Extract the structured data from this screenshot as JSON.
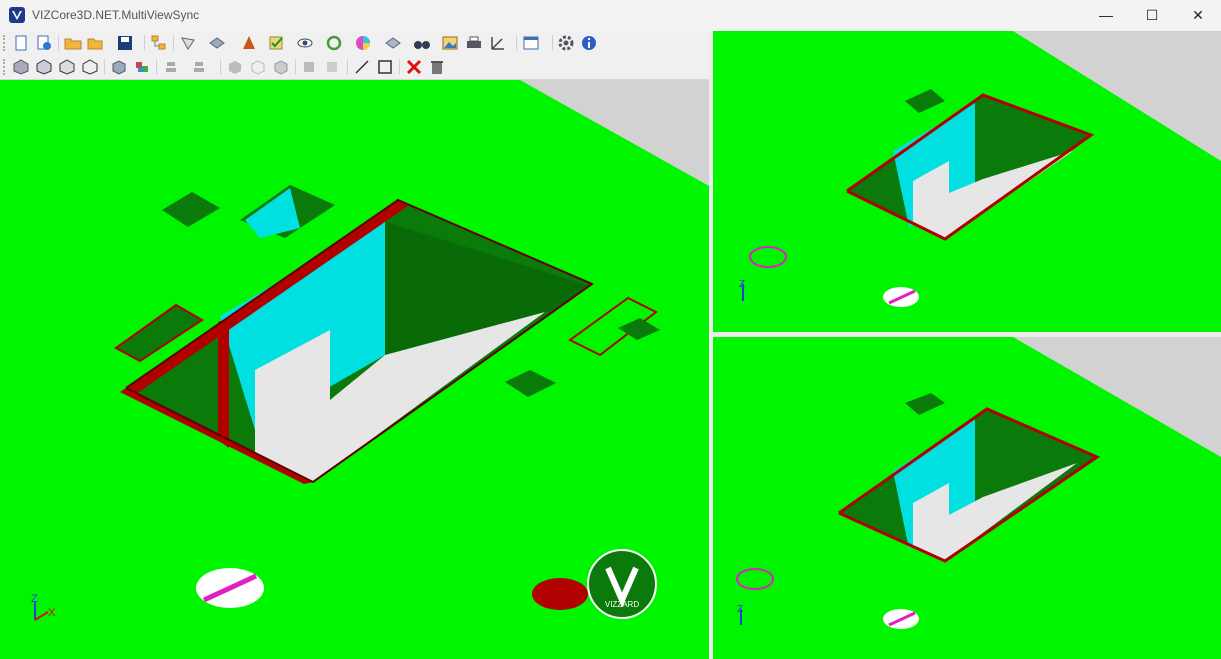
{
  "window": {
    "title": "VIZCore3D.NET.MultiViewSync"
  },
  "caption_buttons": {
    "minimize": "—",
    "maximize": "☐",
    "close": "✕"
  },
  "toolbar1": {
    "icons": [
      "new-document-icon",
      "add-icon",
      "open-folder-icon",
      "open-dropdown-icon",
      "save-icon",
      "model-tree-icon",
      "select-icon",
      "camera-icon",
      "cone-icon",
      "checkbox-icon",
      "eye-icon",
      "rotate-icon",
      "color-wheel-icon",
      "section-icon",
      "binoculars-icon",
      "image-icon",
      "print-icon",
      "measure-icon",
      "window-icon",
      "settings-icon",
      "info-icon"
    ]
  },
  "toolbar2": {
    "icons": [
      "view-iso-icon",
      "view-front-icon",
      "view-top-icon",
      "view-side-icon",
      "box-icon",
      "multi-box-icon",
      "align-icon",
      "align-down-icon",
      "shaded-icon",
      "wire-icon",
      "hidden-icon",
      "light-icon",
      "cut-icon",
      "line-icon",
      "rectangle-icon",
      "delete-icon",
      "trash-icon"
    ]
  },
  "viewer": {
    "logo_text": "VIZZARD",
    "axis": {
      "z": "Z",
      "x": "X",
      "y": "Y"
    },
    "colors": {
      "plate": "#00f500",
      "wall_cyan": "#00e0e0",
      "edge_red": "#b00000",
      "dark_green": "#0a7a0a",
      "floor": "#e6e6e6",
      "background": "#d2d2d2"
    }
  }
}
